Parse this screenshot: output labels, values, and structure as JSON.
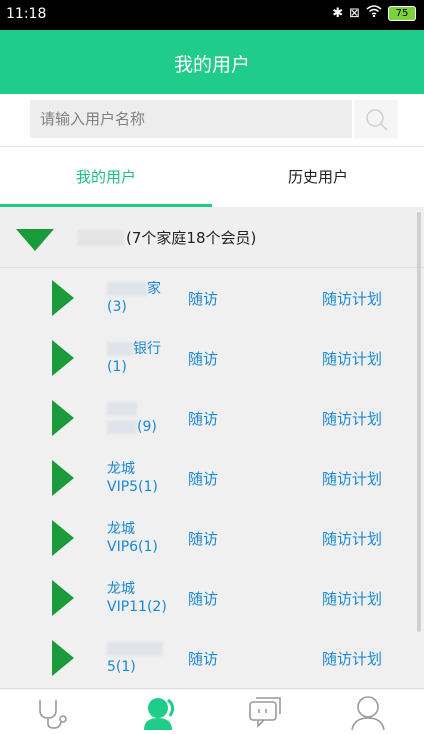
{
  "status_bar": {
    "time": "11:18",
    "battery": "75"
  },
  "header": {
    "title": "我的用户"
  },
  "search": {
    "placeholder": "请输入用户名称"
  },
  "tabs": [
    {
      "label": "我的用户",
      "active": true
    },
    {
      "label": "历史用户",
      "active": false
    }
  ],
  "group": {
    "summary": "(7个家庭18个会员)"
  },
  "rows": [
    {
      "name_top": "家",
      "name_bottom": "(3)",
      "visit": "随访",
      "plan": "随访计划"
    },
    {
      "name_top": "银行",
      "name_bottom": "(1)",
      "visit": "随访",
      "plan": "随访计划"
    },
    {
      "name_top": "",
      "name_bottom": "(9)",
      "visit": "随访",
      "plan": "随访计划"
    },
    {
      "name_top": "龙城",
      "name_bottom": "VIP5(1)",
      "visit": "随访",
      "plan": "随访计划"
    },
    {
      "name_top": "龙城",
      "name_bottom": "VIP6(1)",
      "visit": "随访",
      "plan": "随访计划"
    },
    {
      "name_top": "龙城",
      "name_bottom": "VIP11(2)",
      "visit": "随访",
      "plan": "随访计划"
    },
    {
      "name_top": "",
      "name_bottom": "5(1)",
      "visit": "随访",
      "plan": "随访计划"
    }
  ],
  "bottom_nav": [
    {
      "icon": "stethoscope-icon"
    },
    {
      "icon": "users-icon",
      "active": true
    },
    {
      "icon": "chat-icon"
    },
    {
      "icon": "profile-icon"
    }
  ],
  "colors": {
    "accent": "#1fcc8a",
    "arrow": "#1a9a3a",
    "link": "#1a88d2"
  }
}
